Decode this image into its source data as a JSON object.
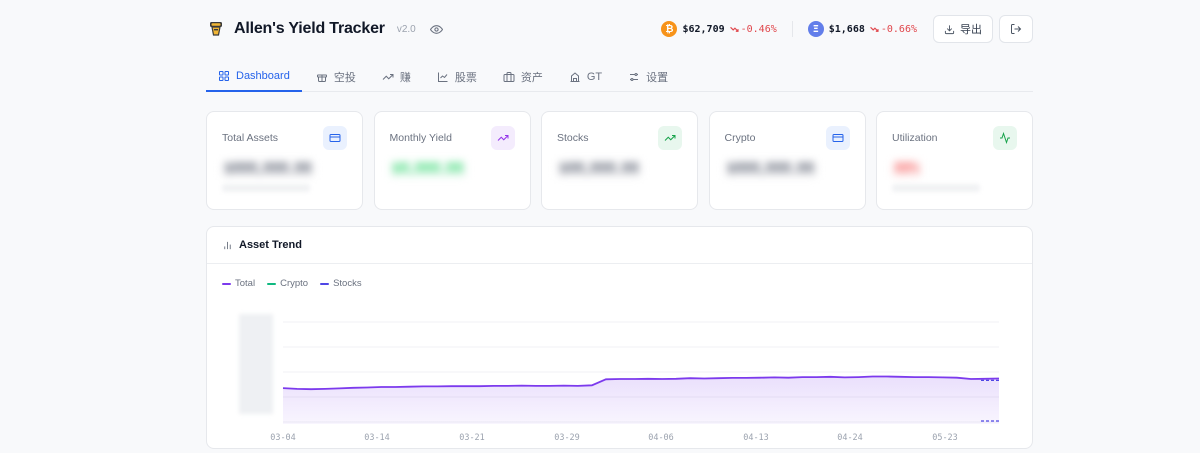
{
  "header": {
    "title": "Allen's Yield Tracker",
    "version": "v2.0",
    "export_label": "导出"
  },
  "tickers": [
    {
      "icon": "bitcoin-icon",
      "symbol": "₿",
      "price": "$62,709",
      "change": "-0.46%",
      "color": "#f7931a"
    },
    {
      "icon": "ethereum-icon",
      "symbol": "Ξ",
      "price": "$1,668",
      "change": "-0.66%",
      "color": "#627eea"
    }
  ],
  "tabs": [
    {
      "label": "Dashboard",
      "icon": "grid-icon",
      "active": true
    },
    {
      "label": "空投",
      "icon": "gift-icon"
    },
    {
      "label": "赚",
      "icon": "trending-up-icon"
    },
    {
      "label": "股票",
      "icon": "line-chart-icon"
    },
    {
      "label": "资产",
      "icon": "briefcase-icon"
    },
    {
      "label": "GT",
      "icon": "building-icon"
    },
    {
      "label": "设置",
      "icon": "sliders-icon"
    }
  ],
  "cards": [
    {
      "label": "Total Assets",
      "icon": "credit-card-icon",
      "value": "$888,888.88",
      "accent": "#2563eb",
      "icon_bg": "#eaf1fe",
      "value_color": "#6b7280"
    },
    {
      "label": "Monthly Yield",
      "icon": "trending-up-icon",
      "value": "$8,888.88",
      "accent": "#9333ea",
      "icon_bg": "#f4ecfd",
      "value_color": "#4ade80"
    },
    {
      "label": "Stocks",
      "icon": "trending-up-icon",
      "value": "$88,888.88",
      "accent": "#16a34a",
      "icon_bg": "#e8f7ee",
      "value_color": "#6b7280"
    },
    {
      "label": "Crypto",
      "icon": "credit-card-icon",
      "value": "$888,888.88",
      "accent": "#2563eb",
      "icon_bg": "#eaf1fe",
      "value_color": "#6b7280"
    },
    {
      "label": "Utilization",
      "icon": "activity-icon",
      "value": "88%",
      "accent": "#16a34a",
      "icon_bg": "#e8f7ee",
      "value_color": "#f87171"
    }
  ],
  "trend": {
    "title": "Asset Trend"
  },
  "chart_data": {
    "type": "area",
    "title": "Asset Trend",
    "series": [
      {
        "name": "Total",
        "color": "#7c3aed"
      },
      {
        "name": "Crypto",
        "color": "#10b981"
      },
      {
        "name": "Stocks",
        "color": "#4f46e5"
      }
    ],
    "x_ticks": [
      "03-04",
      "03-14",
      "03-21",
      "03-29",
      "04-06",
      "04-13",
      "04-24",
      "05-23"
    ],
    "total_values": [
      0.58,
      0.565,
      0.56,
      0.565,
      0.575,
      0.585,
      0.59,
      0.6,
      0.6,
      0.605,
      0.61,
      0.61,
      0.615,
      0.615,
      0.615,
      0.62,
      0.62,
      0.625,
      0.62,
      0.62,
      0.625,
      0.62,
      0.63,
      0.74,
      0.745,
      0.745,
      0.75,
      0.745,
      0.75,
      0.76,
      0.755,
      0.76,
      0.765,
      0.765,
      0.77,
      0.775,
      0.77,
      0.78,
      0.78,
      0.785,
      0.775,
      0.78,
      0.79,
      0.79,
      0.785,
      0.78,
      0.78,
      0.775,
      0.77,
      0.745,
      0.75,
      0.755
    ],
    "stocks_tail": [
      0.72,
      0.72
    ],
    "crypto_tail": [
      0.02,
      0.02
    ],
    "y_axis_labels_hidden": true,
    "grid": true
  }
}
